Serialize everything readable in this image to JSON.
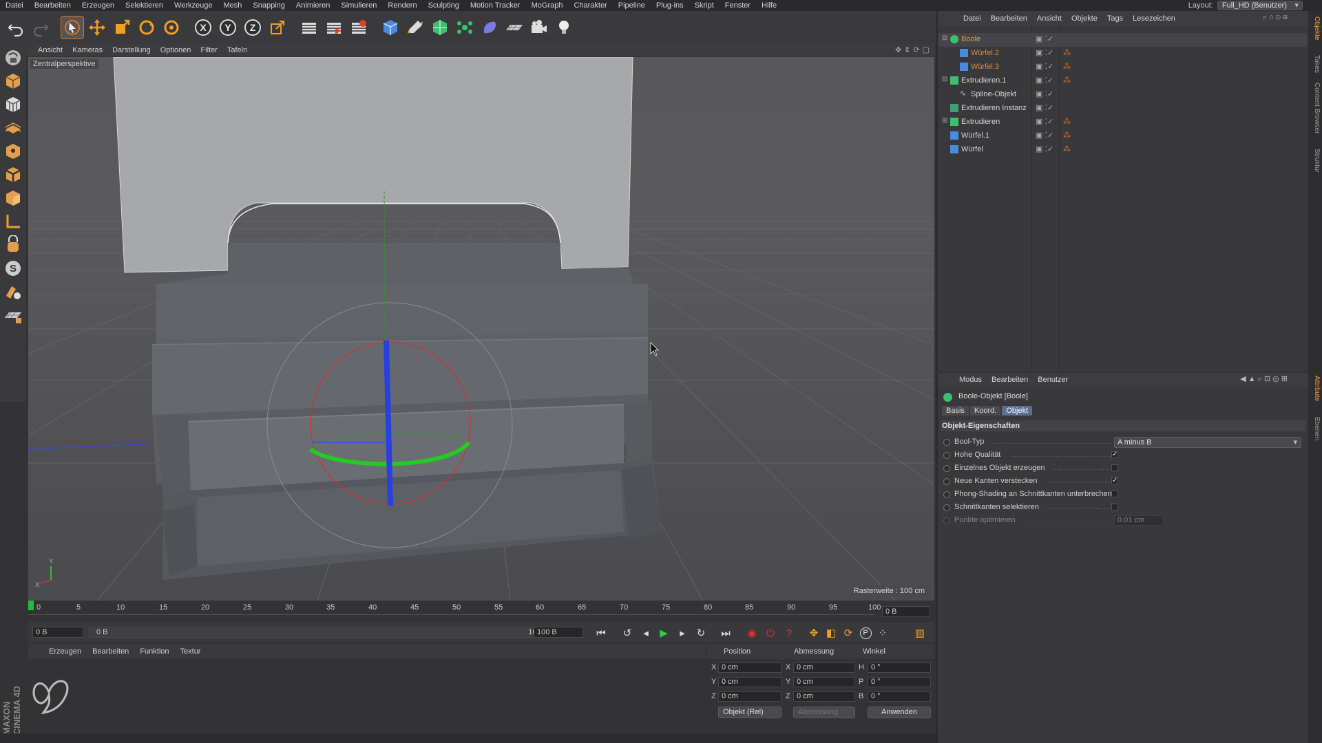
{
  "menubar": {
    "items": [
      "Datei",
      "Bearbeiten",
      "Erzeugen",
      "Selektieren",
      "Werkzeuge",
      "Mesh",
      "Snapping",
      "Animieren",
      "Simulieren",
      "Rendern",
      "Sculpting",
      "Motion Tracker",
      "MoGraph",
      "Charakter",
      "Pipeline",
      "Plug-ins",
      "Skript",
      "Fenster",
      "Hilfe"
    ],
    "layout_label": "Layout:",
    "layout_value": "Full_HD (Benutzer)"
  },
  "toolbar": {
    "icons": [
      "undo-icon",
      "redo-icon",
      "live-select-icon",
      "move-icon",
      "scale-icon",
      "rotate-icon",
      "recent-tool-icon",
      "x-axis-icon",
      "y-axis-icon",
      "z-axis-icon",
      "coordinate-system-icon",
      "render-view-icon",
      "render-picture-viewer-icon",
      "render-settings-icon",
      "cube-icon",
      "pen-icon",
      "subdivision-icon",
      "array-icon",
      "deformer-icon",
      "floor-icon",
      "camera-icon",
      "light-icon"
    ],
    "axis_labels": [
      "X",
      "Y",
      "Z"
    ]
  },
  "left_toolbar": {
    "icons": [
      "make-editable-icon",
      "model-mode-icon",
      "texture-mode-icon",
      "points-mode-icon",
      "edges-mode-icon",
      "polygons-mode-icon",
      "axis-mode-icon",
      "tweak-icon",
      "snap-icon",
      "magnet-icon",
      "workplane-icon",
      "locked-workplane-icon"
    ],
    "snap_label": "S"
  },
  "viewport": {
    "menu": [
      "Ansicht",
      "Kameras",
      "Darstellung",
      "Optionen",
      "Filter",
      "Tafeln"
    ],
    "camera_label": "Zentralperspektive",
    "grid_label": "Rasterweite : 100 cm",
    "axis_y": "Y",
    "axis_x": "X",
    "background_color": "#555558",
    "model_color": "#5e6266"
  },
  "timeline": {
    "ticks": [
      "0",
      "5",
      "10",
      "15",
      "20",
      "25",
      "30",
      "35",
      "40",
      "45",
      "50",
      "55",
      "60",
      "65",
      "70",
      "75",
      "80",
      "85",
      "90",
      "95",
      "100"
    ],
    "current_frame": "0 B"
  },
  "transport": {
    "start_field": "0 B",
    "range_start": "0 B",
    "range_end": "100 B",
    "end_field": "100 B",
    "buttons": [
      "goto-start-icon",
      "prev-key-icon",
      "prev-frame-icon",
      "play-icon",
      "next-frame-icon",
      "next-key-icon",
      "goto-end-icon",
      "record-icon",
      "autokey-icon",
      "keyframe-selection-icon",
      "position-key-icon",
      "scale-key-icon",
      "rotation-key-icon",
      "param-key-icon",
      "point-level-icon",
      "timeline-icon"
    ],
    "param_label": "P"
  },
  "material_panel": {
    "menu": [
      "Erzeugen",
      "Bearbeiten",
      "Funktion",
      "Textur"
    ],
    "brand": "MAXON CINEMA 4D"
  },
  "coord_panel": {
    "headers": [
      "Position",
      "Abmessung",
      "Winkel"
    ],
    "rows": [
      {
        "axis": "X",
        "pos": "0 cm",
        "size_axis": "X",
        "size": "0 cm",
        "rot_axis": "H",
        "rot": "0 °"
      },
      {
        "axis": "Y",
        "pos": "0 cm",
        "size_axis": "Y",
        "size": "0 cm",
        "rot_axis": "P",
        "rot": "0 °"
      },
      {
        "axis": "Z",
        "pos": "0 cm",
        "size_axis": "Z",
        "size": "0 cm",
        "rot_axis": "B",
        "rot": "0 °"
      }
    ],
    "mode_select": "Objekt (Rel)",
    "size_select": "Abmessung",
    "apply_button": "Anwenden"
  },
  "object_manager": {
    "menu": [
      "Datei",
      "Bearbeiten",
      "Ansicht",
      "Objekte",
      "Tags",
      "Lesezeichen"
    ],
    "items": [
      {
        "name": "Boole",
        "indent": 0,
        "style": "active",
        "icon": "boole-icon",
        "tag": false
      },
      {
        "name": "Würfel.2",
        "indent": 1,
        "style": "sel",
        "icon": "cube-icon",
        "tag": true
      },
      {
        "name": "Würfel.3",
        "indent": 1,
        "style": "sel",
        "icon": "cube-icon",
        "tag": true
      },
      {
        "name": "Extrudieren.1",
        "indent": 0,
        "style": "normal",
        "icon": "extrude-icon",
        "tag": true
      },
      {
        "name": "Spline-Objekt",
        "indent": 1,
        "style": "normal",
        "icon": "spline-icon",
        "tag": false
      },
      {
        "name": "Extrudieren Instanz",
        "indent": 0,
        "style": "normal",
        "icon": "instance-icon",
        "tag": false
      },
      {
        "name": "Extrudieren",
        "indent": 0,
        "style": "normal",
        "icon": "extrude-icon",
        "tag": true
      },
      {
        "name": "Würfel.1",
        "indent": 0,
        "style": "normal",
        "icon": "cube-icon",
        "tag": true
      },
      {
        "name": "Würfel",
        "indent": 0,
        "style": "normal",
        "icon": "cube-icon",
        "tag": true
      }
    ]
  },
  "attribute_manager": {
    "menu": [
      "Modus",
      "Bearbeiten",
      "Benutzer"
    ],
    "title": "Boole-Objekt [Boole]",
    "tabs": [
      "Basis",
      "Koord.",
      "Objekt"
    ],
    "active_tab": "Objekt",
    "section": "Objekt-Eigenschaften",
    "props": [
      {
        "label": "Bool-Typ",
        "type": "select",
        "value": "A minus B"
      },
      {
        "label": "Hohe Qualität",
        "type": "check",
        "checked": true
      },
      {
        "label": "Einzelnes Objekt erzeugen",
        "type": "check",
        "checked": false
      },
      {
        "label": "Neue Kanten verstecken",
        "type": "check",
        "checked": true
      },
      {
        "label": "Phong-Shading an Schnittkanten unterbrechen",
        "type": "check",
        "checked": false
      },
      {
        "label": "Schnittkanten selektieren",
        "type": "check",
        "checked": false
      },
      {
        "label": "Punkte optimieren",
        "type": "field",
        "value": "0.01 cm",
        "disabled": true
      }
    ]
  },
  "side_tabs": [
    "Objekte",
    "Takes",
    "Content Browser",
    "Struktur",
    "Attribute",
    "Ebenen"
  ],
  "colors": {
    "accent": "#f0a030",
    "selection": "#5b6f95",
    "axis_red": "#d23030",
    "axis_green": "#22cc22",
    "axis_blue": "#2840e0"
  }
}
